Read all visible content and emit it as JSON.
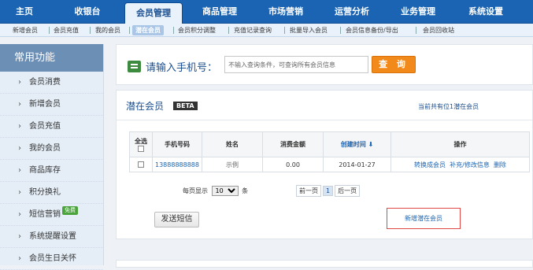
{
  "topnav": {
    "items": [
      "主页",
      "收银台",
      "会员管理",
      "商品管理",
      "市场营销",
      "运营分析",
      "业务管理",
      "系统设置"
    ],
    "active_index": 2
  },
  "subnav": {
    "items": [
      "新增会员",
      "会员充值",
      "我的会员",
      "潜在会员",
      "会员积分调整",
      "充值记录查询",
      "批量导入会员",
      "会员信息备份/导出",
      "会员回收站"
    ],
    "active_index": 3
  },
  "sidebar": {
    "heading": "常用功能",
    "items": [
      "会员消费",
      "新增会员",
      "会员充值",
      "我的会员",
      "商品库存",
      "积分换礼",
      "短信营销",
      "系统提醒设置",
      "会员生日关怀"
    ],
    "badge_text": "免费"
  },
  "search": {
    "label": "请输入手机号：",
    "placeholder": "不输入查询条件，可查询所有会员信息",
    "value": "",
    "button": "查 询"
  },
  "panel": {
    "title": "潜在会员",
    "beta": "BETA",
    "info": "当前共有位1潜在会员",
    "table": {
      "headers": [
        "全选",
        "手机号码",
        "姓名",
        "消费金额",
        "创建时间 ⬇",
        "操作"
      ],
      "rows": [
        {
          "phone": "13888888888",
          "name": "示例",
          "amount": "0.00",
          "created": "2014-01-27",
          "actions": [
            "转换成会员",
            "补充/修改信息",
            "删除"
          ]
        }
      ]
    },
    "pager": {
      "per_page_label": "每页显示",
      "per_page_value": "10",
      "unit": "条",
      "prev": "前一页",
      "current": "1",
      "next": "后一页"
    },
    "send_sms": "发送短信",
    "add_potential": "新增潜在会员"
  },
  "colors": {
    "nav_blue": "#1b64b3",
    "search_orange": "#f28a1b",
    "badge_green": "#4aa43b",
    "highlight_red": "#e04848"
  }
}
